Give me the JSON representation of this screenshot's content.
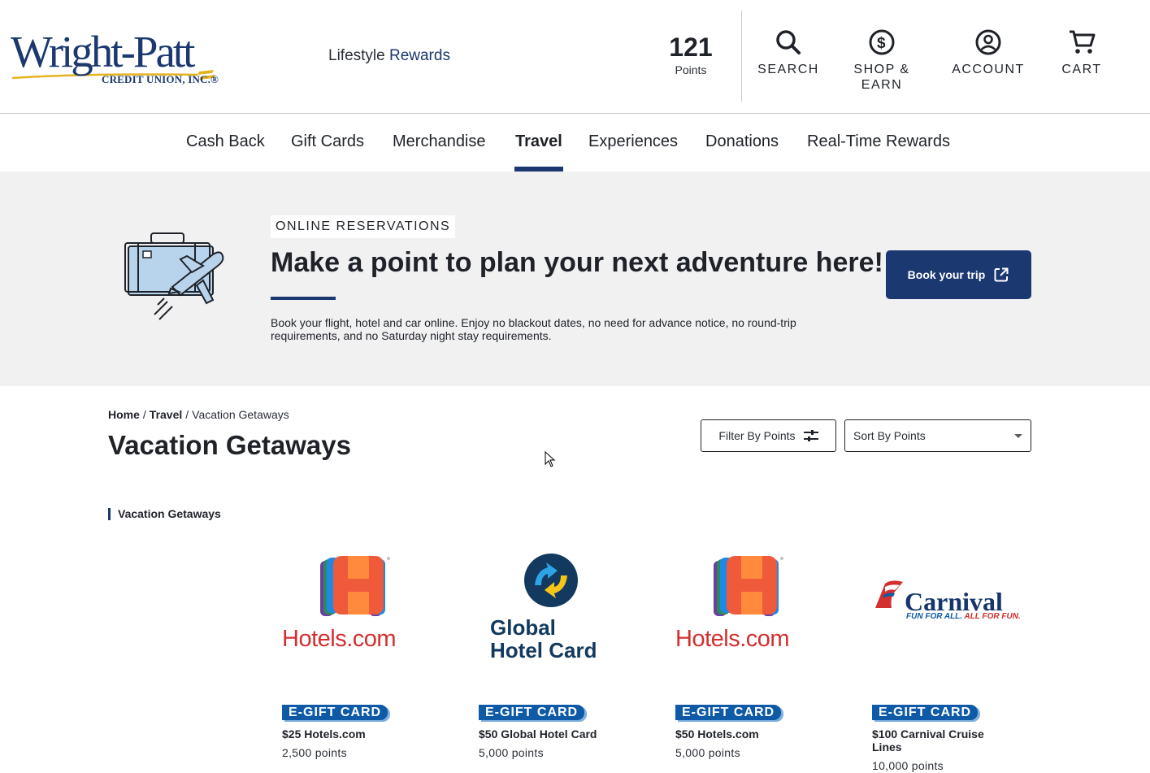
{
  "brand": {
    "logo_main": "Wright-Patt",
    "logo_sub": "CREDIT UNION, INC.®",
    "program_word1": "Lifestyle",
    "program_word2": "Rewards",
    "accent": "#1b3870"
  },
  "header": {
    "points_value": "121",
    "points_label": "Points",
    "nav": [
      {
        "label": "SEARCH",
        "icon": "search-icon"
      },
      {
        "label": "SHOP &\nEARN",
        "icon": "dollar-circle-icon"
      },
      {
        "label": "ACCOUNT",
        "icon": "user-circle-icon"
      },
      {
        "label": "CART",
        "icon": "cart-icon"
      }
    ]
  },
  "categories": [
    {
      "label": "Cash Back",
      "active": false
    },
    {
      "label": "Gift Cards",
      "active": false
    },
    {
      "label": "Merchandise",
      "active": false
    },
    {
      "label": "Travel",
      "active": true
    },
    {
      "label": "Experiences",
      "active": false
    },
    {
      "label": "Donations",
      "active": false
    },
    {
      "label": "Real-Time Rewards",
      "active": false
    }
  ],
  "banner": {
    "tag": "ONLINE RESERVATIONS",
    "title": "Make a point to plan your next adventure here!",
    "description": "Book your flight, hotel and car online. Enjoy no blackout dates, no need for advance notice, no round-trip requirements, and no Saturday night stay requirements.",
    "button_label": "Book your trip",
    "button_icon": "external-link-icon",
    "illustration": "suitcase-airplane-icon"
  },
  "breadcrumb": [
    {
      "label": "Home",
      "link": true
    },
    {
      "label": "Travel",
      "link": true
    },
    {
      "label": "Vacation Getaways",
      "link": false
    }
  ],
  "page_title": "Vacation Getaways",
  "filter": {
    "label": "Filter By Points",
    "icon": "sliders-icon"
  },
  "sort": {
    "selected": "Sort By Points"
  },
  "section_label": "Vacation Getaways",
  "products": [
    {
      "brand_text": "Hotels.com",
      "badge": "E-GIFT CARD",
      "name": "$25 Hotels.com",
      "points": "2,500 points"
    },
    {
      "brand_text_line1": "Global",
      "brand_text_line2": "Hotel Card",
      "badge": "E-GIFT CARD",
      "name": "$50 Global Hotel Card",
      "points": "5,000 points"
    },
    {
      "brand_text": "Hotels.com",
      "badge": "E-GIFT CARD",
      "name": "$50 Hotels.com",
      "points": "5,000 points"
    },
    {
      "brand_text": "Carnival",
      "brand_tagline_a": "FUN FOR ALL.",
      "brand_tagline_b": " ALL FOR FUN.",
      "badge": "E-GIFT CARD",
      "name": "$100 Carnival Cruise Lines",
      "points": "10,000 points"
    }
  ]
}
